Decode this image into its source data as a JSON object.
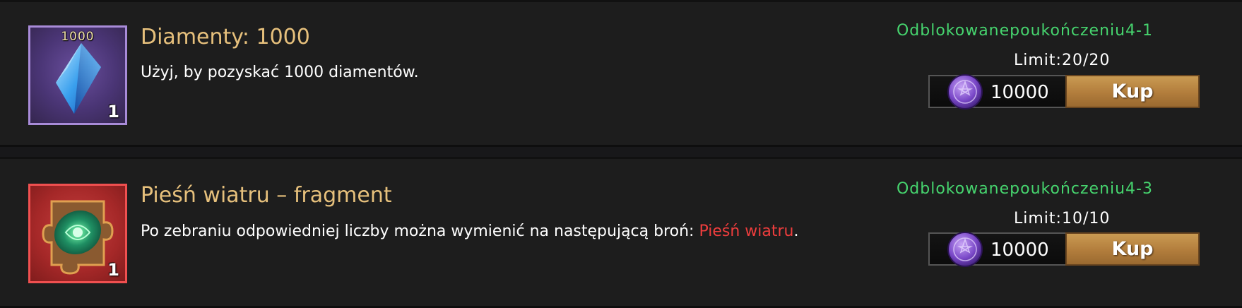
{
  "items": [
    {
      "icon": "blue-diamond-icon",
      "icon_top_label": "1000",
      "count": "1",
      "title": "Diamenty: 1000",
      "description": "Użyj, by pozyskać 1000 diamentów.",
      "unlock": "Odblokowanepoukończeniu4-1",
      "limit": "Limit:20/20",
      "currency_icon": "purple-rune-coin-icon",
      "price": "10000",
      "buy_label": "Kup"
    },
    {
      "icon": "puzzle-fragment-icon",
      "count": "1",
      "title": "Pieśń wiatru – fragment",
      "description_prefix": "Po zebraniu odpowiedniej liczby można wymienić na następującą broń: ",
      "description_highlight": "Pieśń wiatru",
      "description_suffix": ".",
      "unlock": "Odblokowanepoukończeniu4-3",
      "limit": "Limit:10/10",
      "currency_icon": "purple-rune-coin-icon",
      "price": "10000",
      "buy_label": "Kup"
    }
  ],
  "colors": {
    "title": "#e6c07c",
    "unlock": "#46d46e",
    "highlight": "#ef3d3d",
    "buy_button": "#b27d3c",
    "epic_border": "#a88bd8",
    "red_border": "#f05050"
  }
}
